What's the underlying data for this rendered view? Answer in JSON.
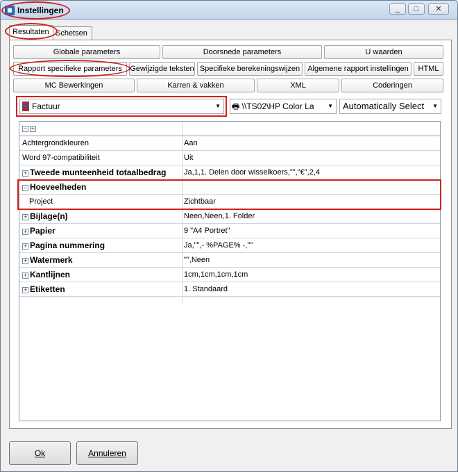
{
  "window": {
    "title": "Instellingen"
  },
  "tabs": [
    "Resultaten",
    "Schetsen"
  ],
  "buttons": {
    "row1": [
      "Globale parameters",
      "Doorsnede parameters",
      "U waarden"
    ],
    "row2": [
      "Rapport specifieke parameters",
      "Gewijzigde teksten",
      "Specifieke berekeningswijzen",
      "Algemene rapport instellingen",
      "HTML"
    ],
    "row3": [
      "MC Bewerkingen",
      "Karren & vakken",
      "XML",
      "Coderingen"
    ]
  },
  "selectors": {
    "report": "Factuur",
    "printer": "\\\\TS02\\HP Color La",
    "mode": "Automatically Select"
  },
  "grid": {
    "rows": [
      {
        "name": "Achtergrondkleuren",
        "value": "Aan"
      },
      {
        "name": "Word 97-compatibiliteit",
        "value": "Uit"
      },
      {
        "name": "Tweede munteenheid totaalbedrag",
        "value": "Ja,1,1. Delen door wisselkoers,\"\",\"€\",2,4"
      },
      {
        "name": "Hoeveelheden",
        "value": ""
      },
      {
        "name": "Project",
        "value": "Zichtbaar"
      },
      {
        "name": "Bijlage(n)",
        "value": "Neen,Neen,1. Folder"
      },
      {
        "name": "Papier",
        "value": "9 \"A4 Portret\""
      },
      {
        "name": "Pagina nummering",
        "value": "Ja,\"\",- %PAGE% -,\"\""
      },
      {
        "name": "Watermerk",
        "value": "\"\",Neen"
      },
      {
        "name": "Kantlijnen",
        "value": "1cm,1cm,1cm,1cm"
      },
      {
        "name": "Etiketten",
        "value": "1. Standaard"
      }
    ]
  },
  "footer": {
    "ok": "Ok",
    "cancel": "Annuleren"
  }
}
